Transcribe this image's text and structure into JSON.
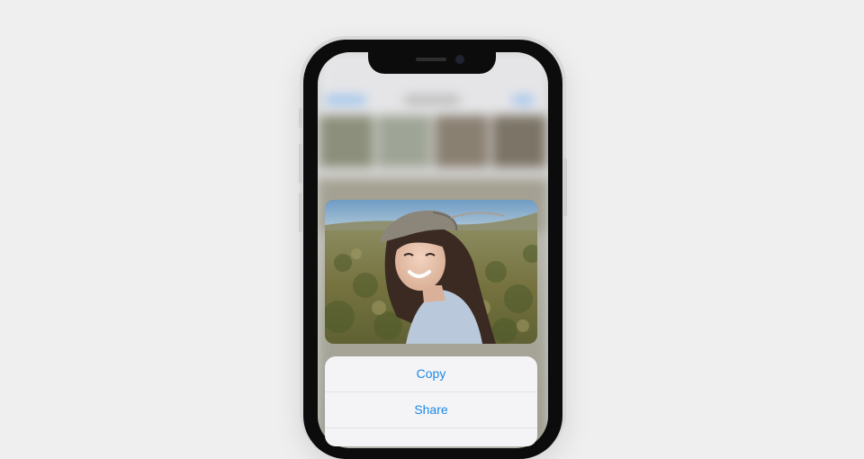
{
  "context_menu": {
    "items": [
      {
        "label": "Copy"
      },
      {
        "label": "Share"
      }
    ]
  },
  "colors": {
    "page_background": "#efefef",
    "menu_text": "#1b88e6",
    "menu_background": "#f4f4f6",
    "phone_frame": "#0c0c0c"
  },
  "preview": {
    "subject": "woman-in-cap-photo"
  }
}
